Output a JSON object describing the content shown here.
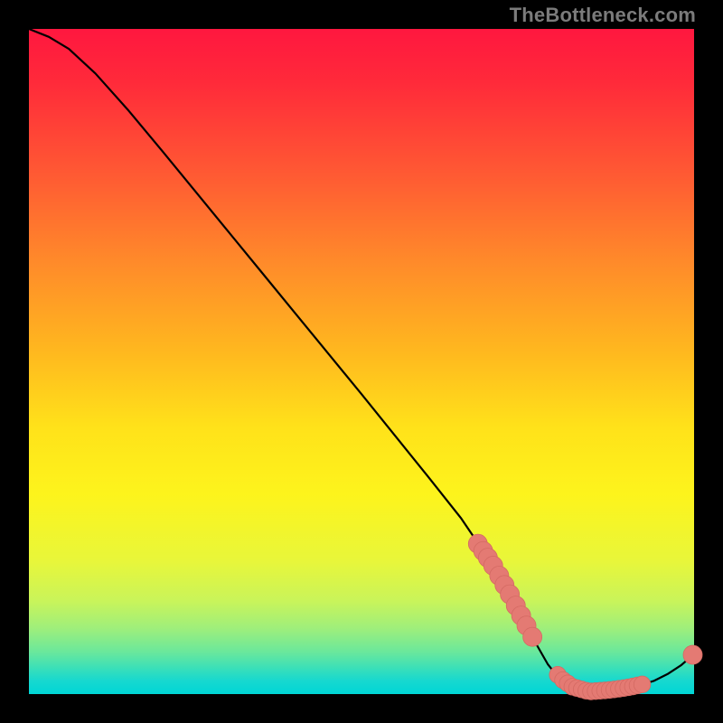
{
  "watermark": "TheBottleneck.com",
  "colors": {
    "curve_stroke": "#000000",
    "dot_fill": "#e47a73",
    "dot_stroke": "#d46a63",
    "bg": "#000000"
  },
  "chart_data": {
    "type": "line",
    "title": "",
    "xlabel": "",
    "ylabel": "",
    "xlim": [
      0,
      100
    ],
    "ylim": [
      0,
      100
    ],
    "grid": false,
    "legend": false,
    "curve_note": "Black curve starts top-left near y=100, falls roughly linearly to a minimum near x≈84 at y≈0, then rises slightly to x=100.",
    "curve": [
      {
        "x": 0,
        "y": 100.0
      },
      {
        "x": 3,
        "y": 98.8
      },
      {
        "x": 6,
        "y": 97.0
      },
      {
        "x": 10,
        "y": 93.3
      },
      {
        "x": 15,
        "y": 87.7
      },
      {
        "x": 20,
        "y": 81.7
      },
      {
        "x": 25,
        "y": 75.6
      },
      {
        "x": 30,
        "y": 69.5
      },
      {
        "x": 35,
        "y": 63.4
      },
      {
        "x": 40,
        "y": 57.3
      },
      {
        "x": 45,
        "y": 51.2
      },
      {
        "x": 50,
        "y": 45.1
      },
      {
        "x": 55,
        "y": 38.9
      },
      {
        "x": 60,
        "y": 32.7
      },
      {
        "x": 65,
        "y": 26.4
      },
      {
        "x": 70,
        "y": 19.0
      },
      {
        "x": 72,
        "y": 15.5
      },
      {
        "x": 74,
        "y": 11.8
      },
      {
        "x": 76,
        "y": 8.0
      },
      {
        "x": 78,
        "y": 4.5
      },
      {
        "x": 80,
        "y": 2.0
      },
      {
        "x": 82,
        "y": 0.8
      },
      {
        "x": 84,
        "y": 0.4
      },
      {
        "x": 86,
        "y": 0.5
      },
      {
        "x": 88,
        "y": 0.7
      },
      {
        "x": 90,
        "y": 1.0
      },
      {
        "x": 92,
        "y": 1.4
      },
      {
        "x": 94,
        "y": 2.0
      },
      {
        "x": 96,
        "y": 3.0
      },
      {
        "x": 98,
        "y": 4.3
      },
      {
        "x": 100,
        "y": 6.0
      }
    ],
    "dots": [
      {
        "x": 67.5,
        "y": 22.6,
        "r": 1.2
      },
      {
        "x": 68.3,
        "y": 21.5,
        "r": 1.2
      },
      {
        "x": 69.0,
        "y": 20.5,
        "r": 1.2
      },
      {
        "x": 69.8,
        "y": 19.3,
        "r": 1.2
      },
      {
        "x": 70.7,
        "y": 17.8,
        "r": 1.2
      },
      {
        "x": 71.5,
        "y": 16.4,
        "r": 1.2
      },
      {
        "x": 72.3,
        "y": 15.0,
        "r": 1.2
      },
      {
        "x": 73.2,
        "y": 13.3,
        "r": 1.2
      },
      {
        "x": 74.0,
        "y": 11.8,
        "r": 1.2
      },
      {
        "x": 74.8,
        "y": 10.3,
        "r": 1.2
      },
      {
        "x": 75.7,
        "y": 8.6,
        "r": 1.2
      },
      {
        "x": 79.5,
        "y": 2.9,
        "r": 1.0
      },
      {
        "x": 80.3,
        "y": 2.1,
        "r": 1.0
      },
      {
        "x": 81.0,
        "y": 1.6,
        "r": 1.0
      },
      {
        "x": 81.7,
        "y": 1.1,
        "r": 1.0
      },
      {
        "x": 82.4,
        "y": 0.9,
        "r": 1.0
      },
      {
        "x": 83.1,
        "y": 0.7,
        "r": 1.0
      },
      {
        "x": 83.8,
        "y": 0.5,
        "r": 1.0
      },
      {
        "x": 84.5,
        "y": 0.4,
        "r": 1.0
      },
      {
        "x": 85.2,
        "y": 0.45,
        "r": 1.0
      },
      {
        "x": 85.9,
        "y": 0.5,
        "r": 1.0
      },
      {
        "x": 86.6,
        "y": 0.55,
        "r": 1.0
      },
      {
        "x": 87.3,
        "y": 0.62,
        "r": 1.0
      },
      {
        "x": 88.0,
        "y": 0.7,
        "r": 1.0
      },
      {
        "x": 88.7,
        "y": 0.8,
        "r": 1.0
      },
      {
        "x": 89.4,
        "y": 0.9,
        "r": 1.0
      },
      {
        "x": 90.1,
        "y": 1.02,
        "r": 1.0
      },
      {
        "x": 90.8,
        "y": 1.15,
        "r": 1.0
      },
      {
        "x": 91.5,
        "y": 1.3,
        "r": 1.0
      },
      {
        "x": 92.2,
        "y": 1.45,
        "r": 1.0
      },
      {
        "x": 99.8,
        "y": 5.9,
        "r": 1.2
      }
    ]
  }
}
